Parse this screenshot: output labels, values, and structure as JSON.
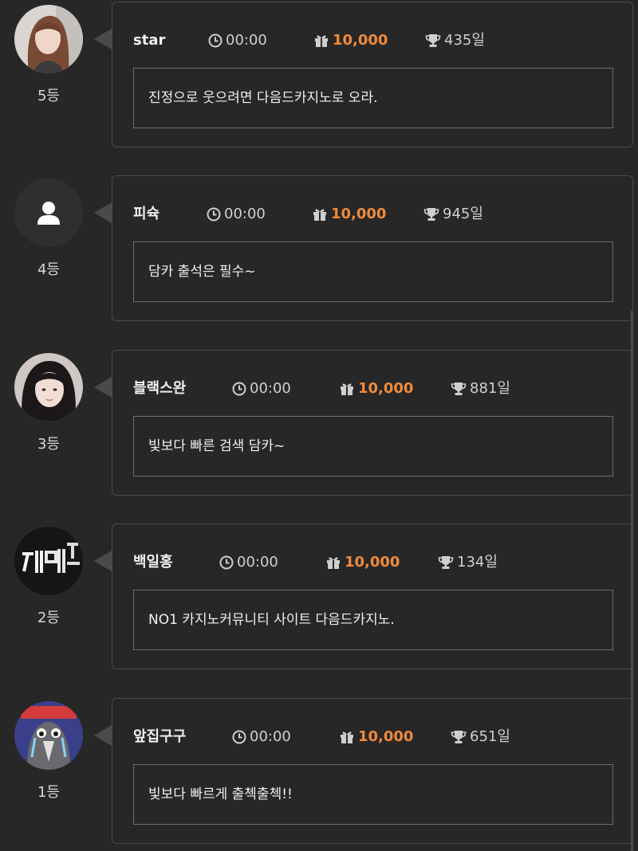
{
  "accent_color": "#f08a3c",
  "entries": [
    {
      "rank_label": "5등",
      "avatar": "woman-photo-icon",
      "name": "star",
      "time": "00:00",
      "points": "10,000",
      "days": "435일",
      "comment": "진정으로 웃으려면 다음드카지노로 오라."
    },
    {
      "rank_label": "4등",
      "avatar": "default-user-icon",
      "name": "피슉",
      "time": "00:00",
      "points": "10,000",
      "days": "945일",
      "comment": "담카 출석은 필수~"
    },
    {
      "rank_label": "3등",
      "avatar": "woman-photo-icon",
      "name": "블랙스완",
      "time": "00:00",
      "points": "10,000",
      "days": "881일",
      "comment": "빛보다 빠른 검색 담카~"
    },
    {
      "rank_label": "2등",
      "avatar": "neon-sign-photo-icon",
      "name": "백일홍",
      "time": "00:00",
      "points": "10,000",
      "days": "134일",
      "comment": "NO1 카지노커뮤니티 사이트 다음드카지노."
    },
    {
      "rank_label": "1등",
      "avatar": "crying-bird-cartoon-icon",
      "name": "앞집구구",
      "time": "00:00",
      "points": "10,000",
      "days": "651일",
      "comment": "빛보다 빠르게 출첵출첵!!"
    }
  ]
}
